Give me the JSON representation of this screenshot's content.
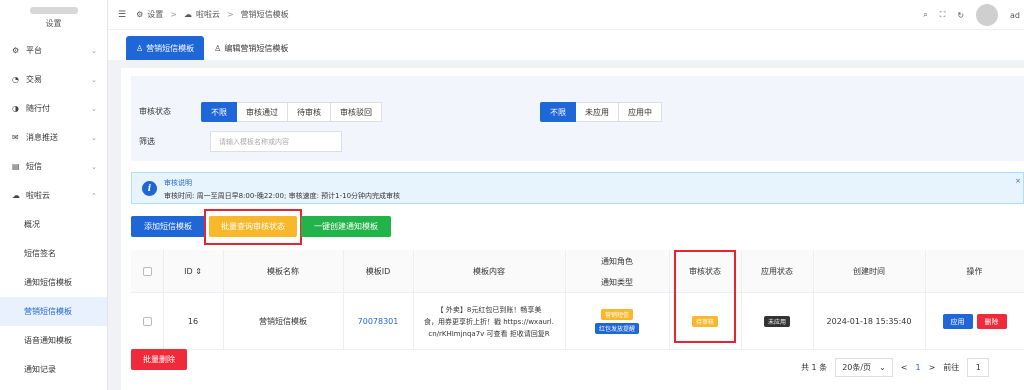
{
  "sidebar": {
    "logo_title": "设置",
    "items": [
      {
        "icon": "gear-icon",
        "glyph": "⚙",
        "label": "平台"
      },
      {
        "icon": "exchange-icon",
        "glyph": "◔",
        "label": "交易"
      },
      {
        "icon": "pay-icon",
        "glyph": "◑",
        "label": "随行付"
      },
      {
        "icon": "push-icon",
        "glyph": "✉",
        "label": "消息推送"
      },
      {
        "icon": "sms-icon",
        "glyph": "▤",
        "label": "短信"
      },
      {
        "icon": "cloud-icon",
        "glyph": "☁",
        "label": "啦啦云"
      }
    ],
    "sub_items": [
      "概况",
      "短信签名",
      "通知短信模板",
      "营销短信模板",
      "语音通知模板",
      "通知记录"
    ]
  },
  "header": {
    "breadcrumb": [
      "设置",
      "啦啦云",
      "营销短信模板"
    ],
    "user": "ad"
  },
  "tabs": [
    "营销短信模板",
    "编辑营销短信模板"
  ],
  "filters": {
    "audit_label": "审核状态",
    "audit_options": [
      "不限",
      "审核通过",
      "待审核",
      "审核驳回"
    ],
    "apply_options": [
      "不限",
      "未应用",
      "应用中"
    ],
    "search_label": "筛选",
    "search_placeholder": "请输入模板名称或内容"
  },
  "notice": {
    "title": "审核说明",
    "text": "审核时间: 周一至周日早8:00-晚22:00;  审核速度: 预计1-10分钟内完成审核",
    "close": "×"
  },
  "actions": {
    "add": "添加短信模板",
    "batch_query": "批量查询审核状态",
    "one_click": "一键创建通知模板",
    "batch_delete": "批量删除"
  },
  "table": {
    "headers": {
      "id": "ID",
      "name": "模板名称",
      "template_id": "模板ID",
      "content": "模板内容",
      "role": "通知角色",
      "type": "通知类型",
      "audit": "审核状态",
      "apply": "应用状态",
      "created": "创建时间",
      "ops": "操作"
    },
    "rows": [
      {
        "id": "16",
        "name": "营销短信模板",
        "template_id": "70078301",
        "content_line1": "【    外卖】8元红包已到账！畅享美",
        "content_line2": "食，用券更享折上折！戳 https://wxaurl.",
        "content_line3": "cn/rKHImjnqa7v 可查看 拒收请回复R",
        "role_tag": "营销短信",
        "type_tag": "红包发放提醒",
        "audit_tag": "待审核",
        "apply_tag": "未应用",
        "created": "2024-01-18 15:35:40",
        "btn_apply": "应用",
        "btn_delete": "删除"
      }
    ]
  },
  "pagination": {
    "total": "共 1 条",
    "page_size": "20条/页",
    "prev": "<",
    "current": "1",
    "next": ">",
    "goto_label": "前往",
    "goto_value": "1"
  },
  "colors": {
    "accent": "#1f66d6",
    "warning": "#f7b82b",
    "success": "#22b34a",
    "danger": "#ef2a3a"
  }
}
